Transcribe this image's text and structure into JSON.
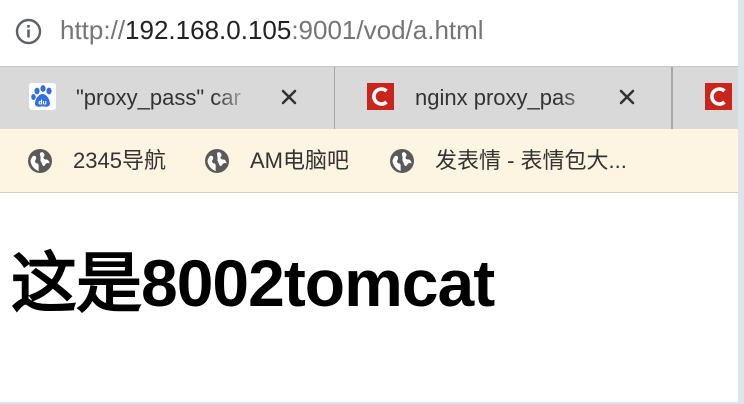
{
  "address_bar": {
    "url_prefix": "http://",
    "url_host": "192.168.0.105",
    "url_rest": ":9001/vod/a.html",
    "info_icon": "info-circle-icon"
  },
  "tabs": [
    {
      "title": "\"proxy_pass\" car",
      "favicon": "baidu-paw-icon",
      "close": "close-icon"
    },
    {
      "title": "nginx proxy_pas",
      "favicon": "csdn-c-icon",
      "close": "close-icon"
    },
    {
      "title": "",
      "favicon": "csdn-c-icon"
    }
  ],
  "bookmarks": [
    {
      "label": "2345导航",
      "icon": "globe-icon"
    },
    {
      "label": "AM电脑吧",
      "icon": "globe-icon"
    },
    {
      "label": "发表情 - 表情包大...",
      "icon": "globe-icon"
    }
  ],
  "page": {
    "heading": "这是8002tomcat"
  },
  "colors": {
    "tab_strip": "#d9d9d9",
    "bookmarks_bar": "#fdf5e1",
    "csdn_red": "#c8261d",
    "baidu_blue": "#2f6ee6"
  }
}
